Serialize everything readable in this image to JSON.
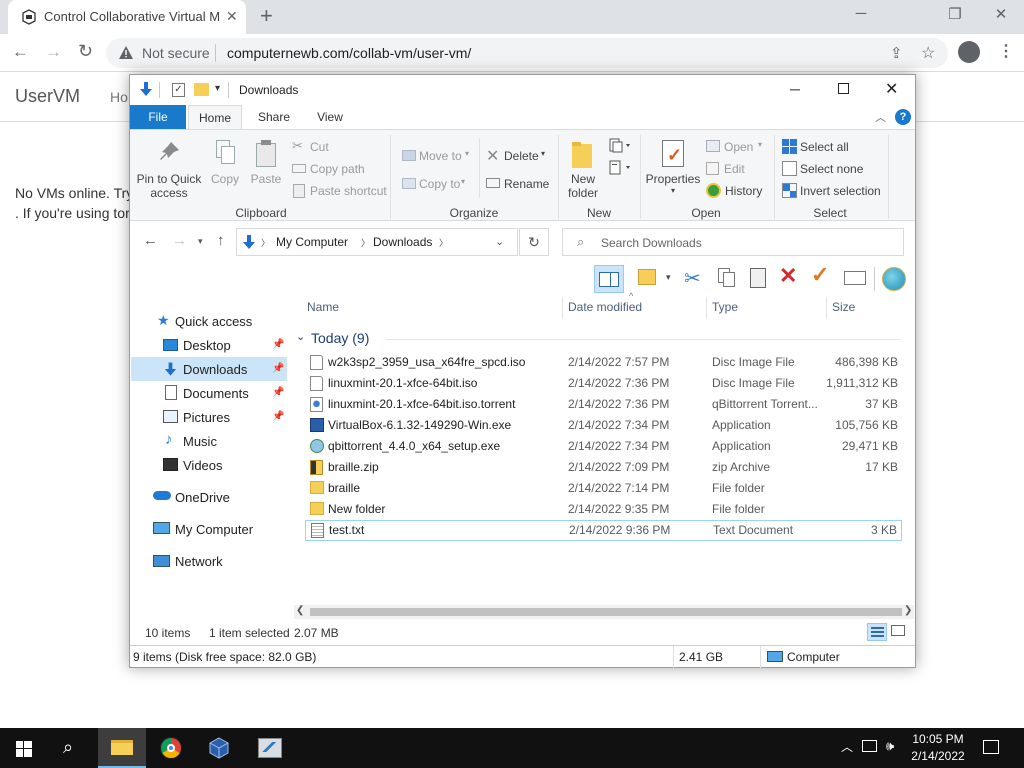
{
  "browser": {
    "tab_title": "Control Collaborative Virtual Ma",
    "new_tab": "+",
    "security_label": "Not secure",
    "url": "computernewb.com/collab-vm/user-vm/"
  },
  "page": {
    "logo": "UserVM",
    "nav_partial": "Ho",
    "message_line1": "No VMs online. Try",
    "message_line2": ". If you're using tor"
  },
  "explorer": {
    "title": "Downloads",
    "ribbon_tabs": [
      "File",
      "Home",
      "Share",
      "View"
    ],
    "clipboard": {
      "pin": "Pin to Quick",
      "pin2": "access",
      "copy": "Copy",
      "paste": "Paste",
      "cut": "Cut",
      "copy_path": "Copy path",
      "paste_shortcut": "Paste shortcut",
      "label": "Clipboard"
    },
    "organize": {
      "move_to": "Move to",
      "copy_to": "Copy to",
      "delete": "Delete",
      "rename": "Rename",
      "label": "Organize"
    },
    "new": {
      "new_folder": "New",
      "new_folder2": "folder",
      "label": "New"
    },
    "open": {
      "properties": "Properties",
      "open": "Open",
      "edit": "Edit",
      "history": "History",
      "label": "Open"
    },
    "select": {
      "select_all": "Select all",
      "select_none": "Select none",
      "invert": "Invert selection",
      "label": "Select"
    },
    "breadcrumb": [
      "My Computer",
      "Downloads"
    ],
    "search_placeholder": "Search Downloads",
    "nav": {
      "quick_access": "Quick access",
      "desktop": "Desktop",
      "downloads": "Downloads",
      "documents": "Documents",
      "pictures": "Pictures",
      "music": "Music",
      "videos": "Videos",
      "onedrive": "OneDrive",
      "my_computer": "My Computer",
      "network": "Network"
    },
    "columns": {
      "name": "Name",
      "date": "Date modified",
      "type": "Type",
      "size": "Size"
    },
    "group_header": "Today (9)",
    "files": [
      {
        "name": "w2k3sp2_3959_usa_x64fre_spcd.iso",
        "date": "2/14/2022 7:57 PM",
        "type": "Disc Image File",
        "size": "486,398 KB"
      },
      {
        "name": "linuxmint-20.1-xfce-64bit.iso",
        "date": "2/14/2022 7:36 PM",
        "type": "Disc Image File",
        "size": "1,911,312 KB"
      },
      {
        "name": "linuxmint-20.1-xfce-64bit.iso.torrent",
        "date": "2/14/2022 7:36 PM",
        "type": "qBittorrent Torrent...",
        "size": "37 KB"
      },
      {
        "name": "VirtualBox-6.1.32-149290-Win.exe",
        "date": "2/14/2022 7:34 PM",
        "type": "Application",
        "size": "105,756 KB"
      },
      {
        "name": "qbittorrent_4.4.0_x64_setup.exe",
        "date": "2/14/2022 7:34 PM",
        "type": "Application",
        "size": "29,471 KB"
      },
      {
        "name": "braille.zip",
        "date": "2/14/2022 7:09 PM",
        "type": "zip Archive",
        "size": "17 KB"
      },
      {
        "name": "braille",
        "date": "2/14/2022 7:14 PM",
        "type": "File folder",
        "size": ""
      },
      {
        "name": "New folder",
        "date": "2/14/2022 9:35 PM",
        "type": "File folder",
        "size": ""
      },
      {
        "name": "test.txt",
        "date": "2/14/2022 9:36 PM",
        "type": "Text Document",
        "size": "3 KB"
      }
    ],
    "status": {
      "items": "10 items",
      "selected": "1 item selected",
      "sel_size": "2.07 MB"
    },
    "details_bar": {
      "left": "9 items (Disk free space: 82.0 GB)",
      "mid": "2.41 GB",
      "right": "Computer"
    }
  },
  "taskbar": {
    "time": "10:05 PM",
    "date": "2/14/2022"
  }
}
